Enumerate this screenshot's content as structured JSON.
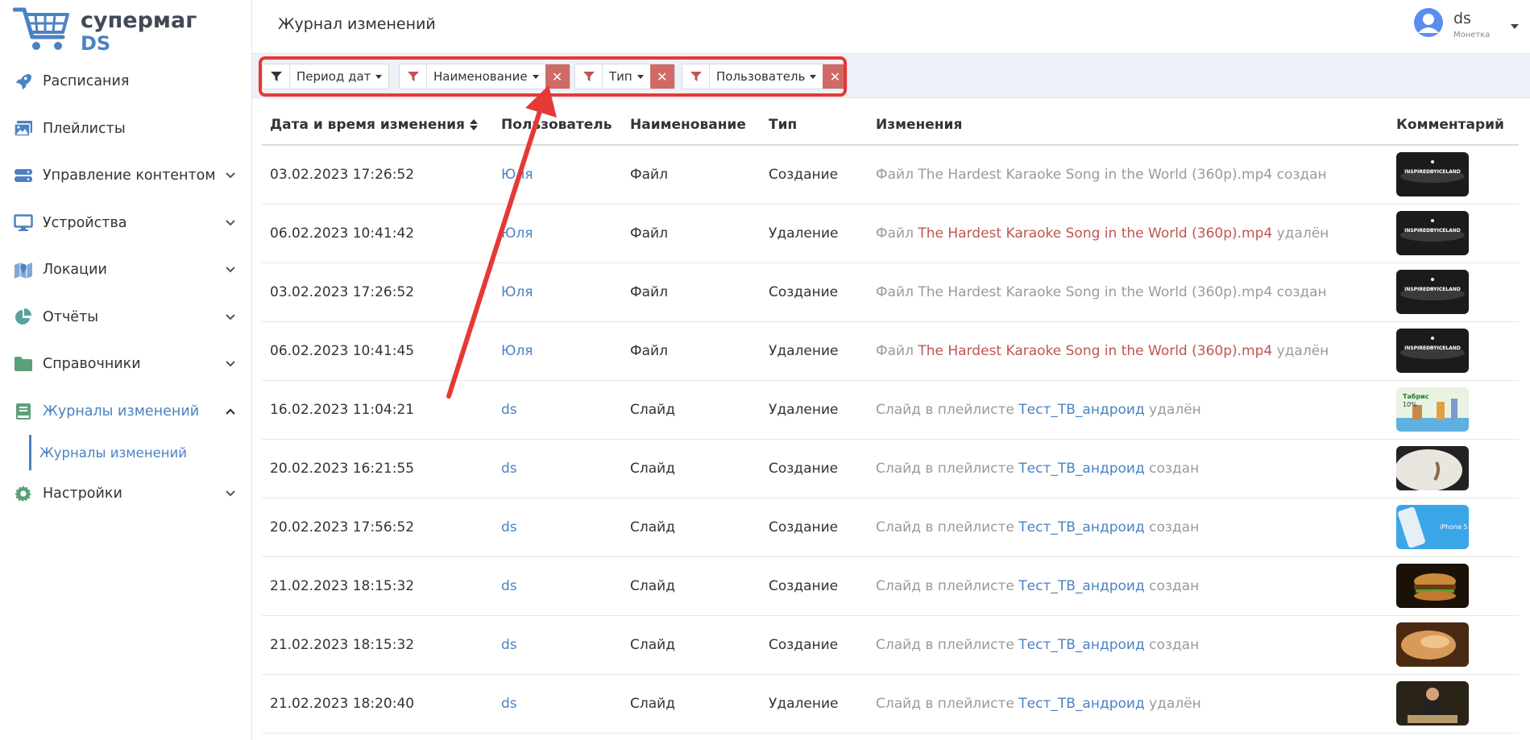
{
  "brand": {
    "line1": "супермаг",
    "line2": "DS"
  },
  "header": {
    "title": "Журнал изменений"
  },
  "user": {
    "name": "ds",
    "org": "Монетка"
  },
  "sidebar": {
    "items": [
      {
        "label": "Расписания",
        "icon": "rocket-icon",
        "has_chevron": false
      },
      {
        "label": "Плейлисты",
        "icon": "images-icon",
        "has_chevron": false
      },
      {
        "label": "Управление контентом",
        "icon": "server-icon",
        "has_chevron": true
      },
      {
        "label": "Устройства",
        "icon": "monitor-icon",
        "has_chevron": true
      },
      {
        "label": "Локации",
        "icon": "map-icon",
        "has_chevron": true
      },
      {
        "label": "Отчёты",
        "icon": "pie-chart-icon",
        "has_chevron": true
      },
      {
        "label": "Справочники",
        "icon": "folder-icon",
        "has_chevron": true
      },
      {
        "label": "Журналы изменений",
        "icon": "book-icon",
        "has_chevron": true,
        "active": true
      },
      {
        "label": "Настройки",
        "icon": "gear-icon",
        "has_chevron": true
      }
    ],
    "subitem": "Журналы изменений"
  },
  "filters": [
    {
      "label": "Период дат",
      "closable": false
    },
    {
      "label": "Наименование",
      "closable": true
    },
    {
      "label": "Тип",
      "closable": true
    },
    {
      "label": "Пользователь",
      "closable": true
    }
  ],
  "table": {
    "columns": [
      "Дата и время изменения",
      "Пользователь",
      "Наименование",
      "Тип",
      "Изменения",
      "Комментарий"
    ],
    "rows": [
      {
        "date": "03.02.2023 17:26:52",
        "user": "Юля",
        "name": "Файл",
        "type": "Создание",
        "ch_pre": "Файл The Hardest Karaoke Song in the World (360p).mp4 создан",
        "ch_link": "",
        "ch_post": "",
        "link_style": "none",
        "thumb": "iceland"
      },
      {
        "date": "06.02.2023 10:41:42",
        "user": "Юля",
        "name": "Файл",
        "type": "Удаление",
        "ch_pre": "Файл ",
        "ch_link": "The Hardest Karaoke Song in the World (360p).mp4",
        "ch_post": " удалён",
        "link_style": "red",
        "thumb": "iceland"
      },
      {
        "date": "03.02.2023 17:26:52",
        "user": "Юля",
        "name": "Файл",
        "type": "Создание",
        "ch_pre": "Файл The Hardest Karaoke Song in the World (360p).mp4 создан",
        "ch_link": "",
        "ch_post": "",
        "link_style": "none",
        "thumb": "iceland"
      },
      {
        "date": "06.02.2023 10:41:45",
        "user": "Юля",
        "name": "Файл",
        "type": "Удаление",
        "ch_pre": "Файл ",
        "ch_link": "The Hardest Karaoke Song in the World (360p).mp4",
        "ch_post": " удалён",
        "link_style": "red",
        "thumb": "iceland"
      },
      {
        "date": "16.02.2023 11:04:21",
        "user": "ds",
        "name": "Слайд",
        "type": "Удаление",
        "ch_pre": "Слайд  в плейлисте ",
        "ch_link": "Тест_ТВ_андроид",
        "ch_post": "  удалён",
        "link_style": "blue",
        "thumb": "tabris"
      },
      {
        "date": "20.02.2023 16:21:55",
        "user": "ds",
        "name": "Слайд",
        "type": "Создание",
        "ch_pre": "Слайд в плейлисте ",
        "ch_link": "Тест_ТВ_андроид",
        "ch_post": " создан",
        "link_style": "blue",
        "thumb": "hand"
      },
      {
        "date": "20.02.2023 17:56:52",
        "user": "ds",
        "name": "Слайд",
        "type": "Создание",
        "ch_pre": "Слайд в плейлисте ",
        "ch_link": "Тест_ТВ_андроид",
        "ch_post": " создан",
        "link_style": "blue",
        "thumb": "iphone"
      },
      {
        "date": "21.02.2023 18:15:32",
        "user": "ds",
        "name": "Слайд",
        "type": "Создание",
        "ch_pre": "Слайд в плейлисте ",
        "ch_link": "Тест_ТВ_андроид",
        "ch_post": " создан",
        "link_style": "blue",
        "thumb": "burger"
      },
      {
        "date": "21.02.2023 18:15:32",
        "user": "ds",
        "name": "Слайд",
        "type": "Создание",
        "ch_pre": "Слайд в плейлисте ",
        "ch_link": "Тест_ТВ_андроид",
        "ch_post": " создан",
        "link_style": "blue",
        "thumb": "bread"
      },
      {
        "date": "21.02.2023 18:20:40",
        "user": "ds",
        "name": "Слайд",
        "type": "Удаление",
        "ch_pre": "Слайд  в плейлисте ",
        "ch_link": "Тест_ТВ_андроид",
        "ch_post": "  удалён",
        "link_style": "blue",
        "thumb": "chef"
      }
    ]
  },
  "colors": {
    "accent": "#4b82c3",
    "danger": "#d06a64",
    "highlight": "#e53935"
  }
}
